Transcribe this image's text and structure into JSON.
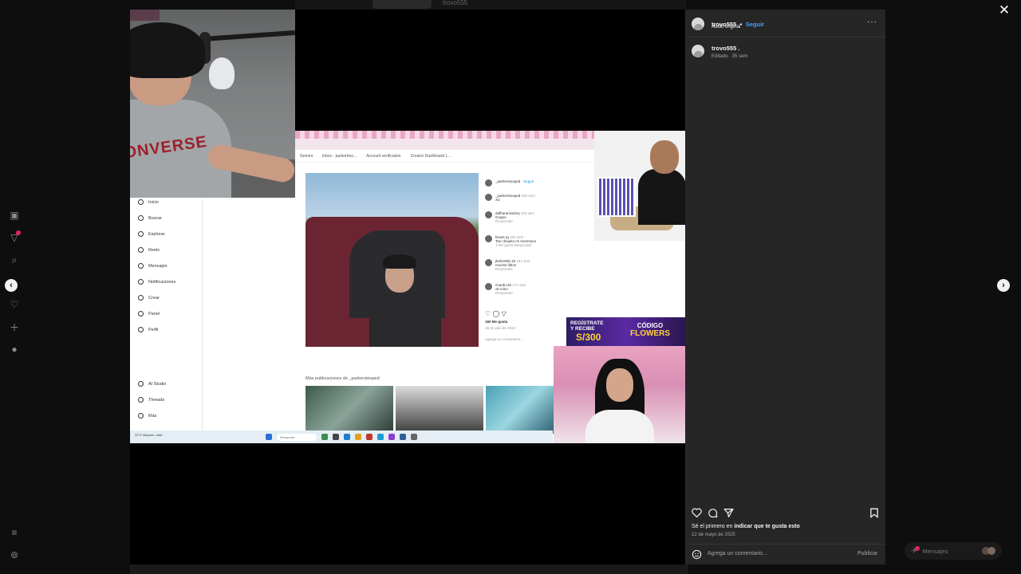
{
  "background": {
    "tab_label": "trovo555"
  },
  "video": {
    "screen": {
      "bookmarks": [
        "Gemini",
        "Inbox - parkerhoo...",
        "Account verification",
        "Creator Dashboard L..."
      ],
      "sidebar": [
        "Inicio",
        "Buscar",
        "Explorar",
        "Reels",
        "Mensajes",
        "Notificaciones",
        "Crear",
        "Panel",
        "Perfil",
        "AI Studio",
        "Threads",
        "Más"
      ],
      "comments_header": {
        "user": "_parkerstooped",
        "follow": "Seguir"
      },
      "comments": [
        {
          "user": "_parkerstooped",
          "time": "336 sem",
          "text": "Xd"
        },
        {
          "user": "dafharanivalonj",
          "time": "162 sem",
          "text": "Guapo",
          "reply": "Responder"
        },
        {
          "user": "bruan.rg",
          "time": "153 sem",
          "text": "Tan chiquito mi morenazo",
          "reply": "1 Me gusta  Responder"
        },
        {
          "user": "jhefer606.18",
          "time": "151 sem",
          "text": "muchis filtros",
          "reply": "Responder"
        },
        {
          "user": "ricardu.26",
          "time": "177 sem",
          "text": "ok mino",
          "reply": "Responder"
        }
      ],
      "likes": "160 Me gusta",
      "post_date": "25 de julio de 2022",
      "add_comment": "Agrega un comentario...",
      "more_from": "Más publicaciones de _parkerstooped",
      "search_label": "Búsqueda",
      "weather": "Mayorm. nubl.",
      "temp": "22°C"
    },
    "ad": {
      "line1": "REGÍSTRATE",
      "line2": "Y RECIBE",
      "amount": "S/300",
      "code_label": "CÓDIGO",
      "code": "FLOWERS"
    }
  },
  "panel": {
    "user": "trovo555",
    "separator": "•",
    "follow": "Seguir",
    "audio": "Audio original",
    "more": "···",
    "caption_user": "trovo555 .",
    "caption_meta": "Editado · 35 sem",
    "first_like_prefix": "Sé el primero en ",
    "first_like_link": "indicar que te gusta esto",
    "date": "12 de mayo de 2025",
    "comment_placeholder": "Agrega un comentario...",
    "publish": "Publicar"
  },
  "messages": {
    "label": "Mensajes"
  },
  "icons": {
    "close": "close-icon",
    "prev": "chevron-left-icon",
    "next": "chevron-right-icon",
    "like": "heart-icon",
    "comment": "comment-icon",
    "share": "send-icon",
    "save": "bookmark-icon",
    "emoji": "emoji-icon"
  }
}
